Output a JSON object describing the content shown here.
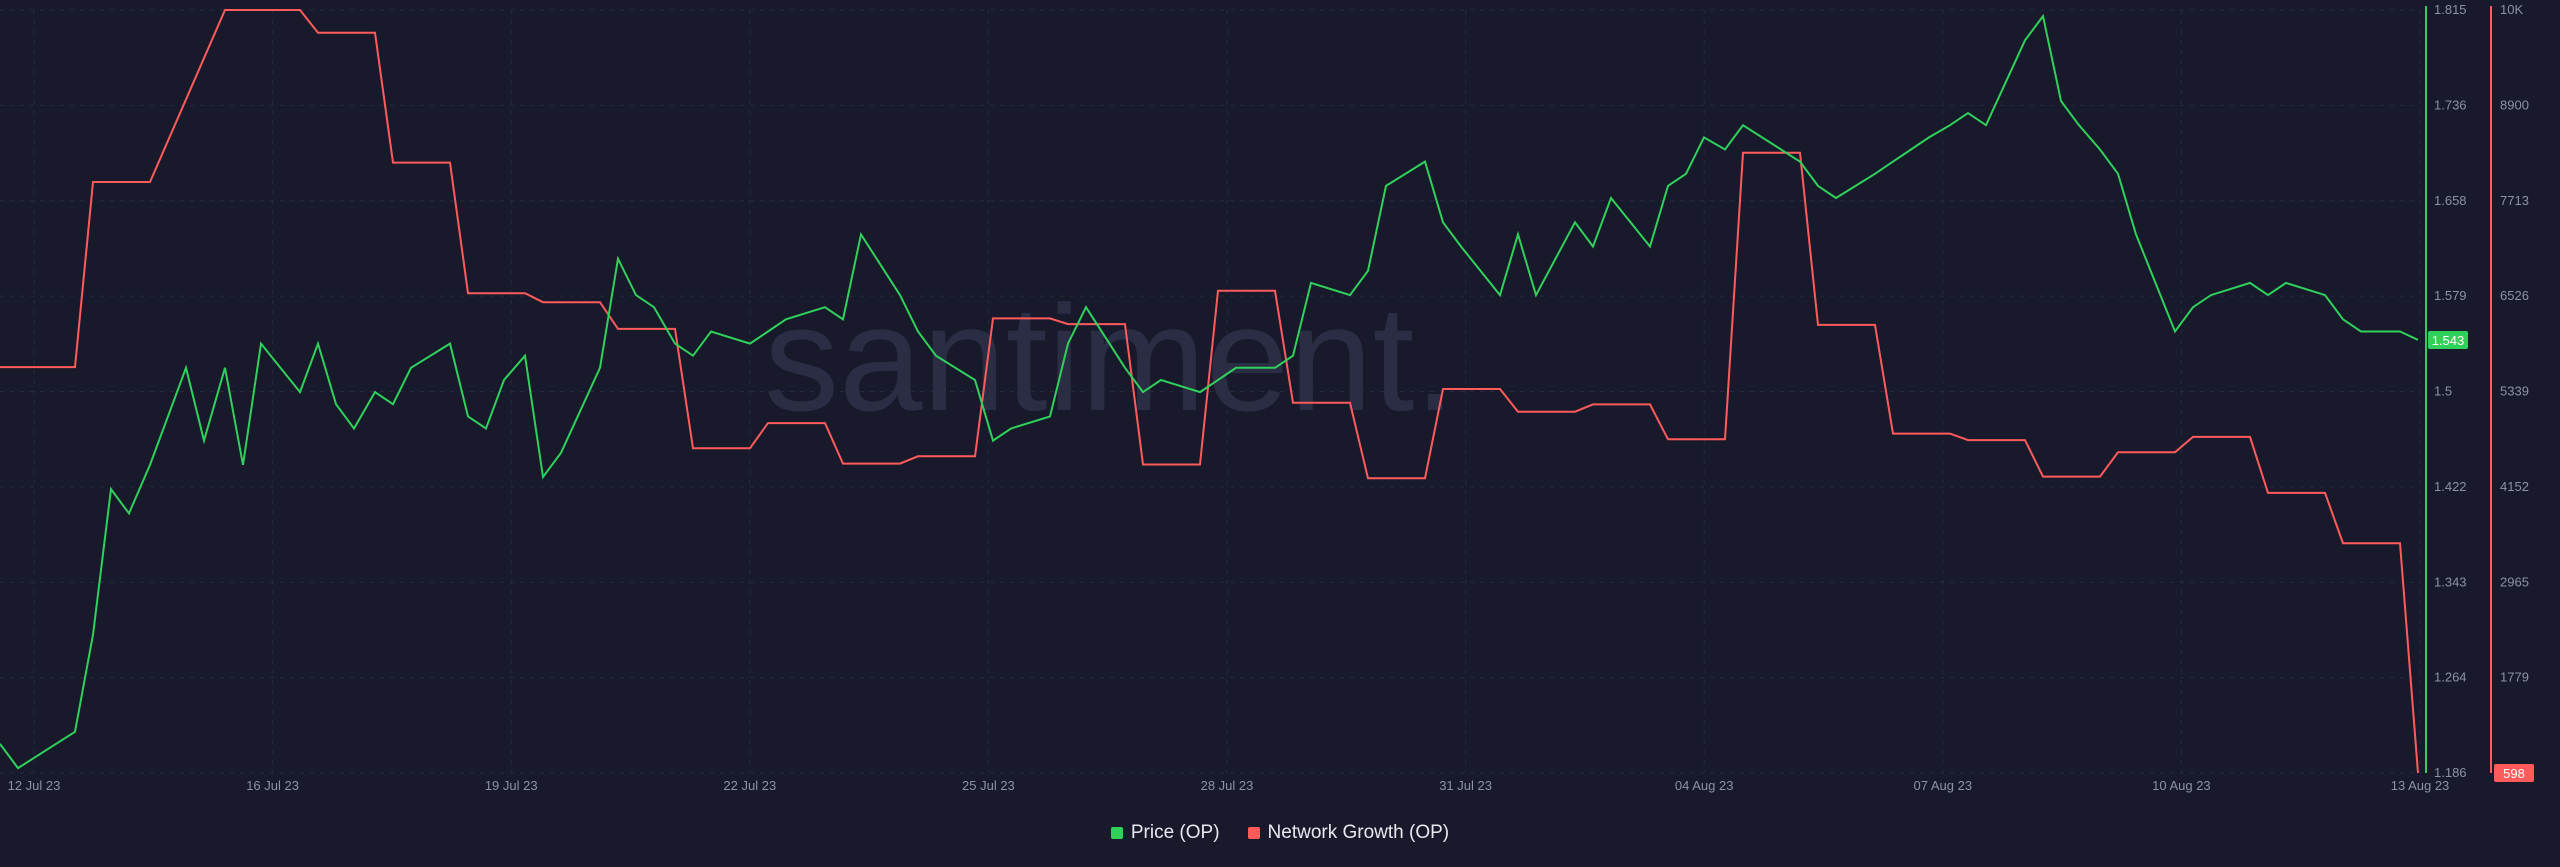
{
  "watermark": "santiment.",
  "colors": {
    "background": "#181a2c",
    "grid": "#262a3f",
    "price": "#2fd15a",
    "network": "#ff5b5b",
    "tick": "#8d90a6"
  },
  "legend": [
    {
      "label": "Price (OP)",
      "color": "#2fd15a"
    },
    {
      "label": "Network Growth (OP)",
      "color": "#ff5b5b"
    }
  ],
  "chart_data": {
    "type": "line",
    "x_ticks": [
      "12 Jul 23",
      "16 Jul 23",
      "19 Jul 23",
      "22 Jul 23",
      "25 Jul 23",
      "28 Jul 23",
      "31 Jul 23",
      "04 Aug 23",
      "07 Aug 23",
      "10 Aug 23",
      "13 Aug 23"
    ],
    "x_range": [
      "2023-07-12",
      "2023-08-13"
    ],
    "price_axis": {
      "ticks": [
        "1.815",
        "1.736",
        "1.658",
        "1.579",
        "1.5",
        "1.422",
        "1.343",
        "1.264",
        "1.186"
      ],
      "ylim": [
        1.186,
        1.815
      ],
      "current": "1.543"
    },
    "network_axis": {
      "ticks": [
        "10K",
        "8900",
        "7713",
        "6526",
        "5339",
        "4152",
        "2965",
        "1779"
      ],
      "ylim": [
        598,
        10000
      ],
      "current": "598"
    },
    "series": [
      {
        "name": "Price (OP)",
        "axis": "price",
        "points": [
          [
            "2023-07-12",
            1.21
          ],
          [
            "2023-07-12",
            1.19
          ],
          [
            "2023-07-13",
            1.22
          ],
          [
            "2023-07-13",
            1.3
          ],
          [
            "2023-07-13",
            1.42
          ],
          [
            "2023-07-13",
            1.4
          ],
          [
            "2023-07-14",
            1.44
          ],
          [
            "2023-07-14",
            1.48
          ],
          [
            "2023-07-14",
            1.52
          ],
          [
            "2023-07-14",
            1.46
          ],
          [
            "2023-07-15",
            1.52
          ],
          [
            "2023-07-15",
            1.44
          ],
          [
            "2023-07-15",
            1.54
          ],
          [
            "2023-07-16",
            1.5
          ],
          [
            "2023-07-16",
            1.54
          ],
          [
            "2023-07-16",
            1.49
          ],
          [
            "2023-07-16",
            1.47
          ],
          [
            "2023-07-17",
            1.5
          ],
          [
            "2023-07-17",
            1.49
          ],
          [
            "2023-07-17",
            1.52
          ],
          [
            "2023-07-18",
            1.54
          ],
          [
            "2023-07-18",
            1.48
          ],
          [
            "2023-07-18",
            1.47
          ],
          [
            "2023-07-18",
            1.51
          ],
          [
            "2023-07-19",
            1.53
          ],
          [
            "2023-07-19",
            1.43
          ],
          [
            "2023-07-19",
            1.45
          ],
          [
            "2023-07-20",
            1.52
          ],
          [
            "2023-07-20",
            1.61
          ],
          [
            "2023-07-20",
            1.58
          ],
          [
            "2023-07-20",
            1.57
          ],
          [
            "2023-07-21",
            1.54
          ],
          [
            "2023-07-21",
            1.53
          ],
          [
            "2023-07-21",
            1.55
          ],
          [
            "2023-07-22",
            1.54
          ],
          [
            "2023-07-22",
            1.55
          ],
          [
            "2023-07-22",
            1.56
          ],
          [
            "2023-07-23",
            1.57
          ],
          [
            "2023-07-23",
            1.56
          ],
          [
            "2023-07-23",
            1.63
          ],
          [
            "2023-07-24",
            1.58
          ],
          [
            "2023-07-24",
            1.55
          ],
          [
            "2023-07-24",
            1.53
          ],
          [
            "2023-07-25",
            1.51
          ],
          [
            "2023-07-25",
            1.46
          ],
          [
            "2023-07-25",
            1.47
          ],
          [
            "2023-07-26",
            1.48
          ],
          [
            "2023-07-26",
            1.54
          ],
          [
            "2023-07-26",
            1.57
          ],
          [
            "2023-07-27",
            1.52
          ],
          [
            "2023-07-27",
            1.5
          ],
          [
            "2023-07-27",
            1.51
          ],
          [
            "2023-07-28",
            1.5
          ],
          [
            "2023-07-28",
            1.51
          ],
          [
            "2023-07-28",
            1.52
          ],
          [
            "2023-07-29",
            1.52
          ],
          [
            "2023-07-29",
            1.53
          ],
          [
            "2023-07-29",
            1.59
          ],
          [
            "2023-07-30",
            1.58
          ],
          [
            "2023-07-30",
            1.6
          ],
          [
            "2023-07-30",
            1.67
          ],
          [
            "2023-07-31",
            1.69
          ],
          [
            "2023-07-31",
            1.64
          ],
          [
            "2023-07-31",
            1.62
          ],
          [
            "2023-08-01",
            1.58
          ],
          [
            "2023-08-01",
            1.63
          ],
          [
            "2023-08-01",
            1.58
          ],
          [
            "2023-08-02",
            1.64
          ],
          [
            "2023-08-02",
            1.62
          ],
          [
            "2023-08-02",
            1.66
          ],
          [
            "2023-08-03",
            1.62
          ],
          [
            "2023-08-03",
            1.67
          ],
          [
            "2023-08-03",
            1.68
          ],
          [
            "2023-08-03",
            1.71
          ],
          [
            "2023-08-04",
            1.7
          ],
          [
            "2023-08-04",
            1.72
          ],
          [
            "2023-08-05",
            1.69
          ],
          [
            "2023-08-05",
            1.67
          ],
          [
            "2023-08-05",
            1.66
          ],
          [
            "2023-08-06",
            1.68
          ],
          [
            "2023-08-06",
            1.69
          ],
          [
            "2023-08-06",
            1.7
          ],
          [
            "2023-08-06",
            1.71
          ],
          [
            "2023-08-07",
            1.72
          ],
          [
            "2023-08-07",
            1.73
          ],
          [
            "2023-08-07",
            1.72
          ],
          [
            "2023-08-08",
            1.79
          ],
          [
            "2023-08-08",
            1.81
          ],
          [
            "2023-08-08",
            1.74
          ],
          [
            "2023-08-08",
            1.72
          ],
          [
            "2023-08-09",
            1.7
          ],
          [
            "2023-08-09",
            1.68
          ],
          [
            "2023-08-09",
            1.63
          ],
          [
            "2023-08-10",
            1.55
          ],
          [
            "2023-08-10",
            1.57
          ],
          [
            "2023-08-10",
            1.58
          ],
          [
            "2023-08-11",
            1.59
          ],
          [
            "2023-08-11",
            1.58
          ],
          [
            "2023-08-11",
            1.59
          ],
          [
            "2023-08-12",
            1.58
          ],
          [
            "2023-08-12",
            1.56
          ],
          [
            "2023-08-12",
            1.55
          ],
          [
            "2023-08-13",
            1.55
          ],
          [
            "2023-08-13",
            1.543
          ]
        ]
      },
      {
        "name": "Network Growth (OP)",
        "axis": "network",
        "points": [
          [
            "2023-07-12",
            5600
          ],
          [
            "2023-07-13",
            5600
          ],
          [
            "2023-07-13",
            7880
          ],
          [
            "2023-07-14",
            7880
          ],
          [
            "2023-07-15",
            10000
          ],
          [
            "2023-07-16",
            10000
          ],
          [
            "2023-07-16",
            9720
          ],
          [
            "2023-07-17",
            9720
          ],
          [
            "2023-07-17",
            8120
          ],
          [
            "2023-07-18",
            8120
          ],
          [
            "2023-07-18",
            6510
          ],
          [
            "2023-07-19",
            6510
          ],
          [
            "2023-07-19",
            6400
          ],
          [
            "2023-07-20",
            6400
          ],
          [
            "2023-07-20",
            6070
          ],
          [
            "2023-07-21",
            6070
          ],
          [
            "2023-07-21",
            4600
          ],
          [
            "2023-07-22",
            4600
          ],
          [
            "2023-07-22",
            4910
          ],
          [
            "2023-07-23",
            4910
          ],
          [
            "2023-07-23",
            4410
          ],
          [
            "2023-07-24",
            4410
          ],
          [
            "2023-07-24",
            4500
          ],
          [
            "2023-07-25",
            4500
          ],
          [
            "2023-07-25",
            6200
          ],
          [
            "2023-07-26",
            6200
          ],
          [
            "2023-07-26",
            6130
          ],
          [
            "2023-07-27",
            6130
          ],
          [
            "2023-07-27",
            4400
          ],
          [
            "2023-07-28",
            4400
          ],
          [
            "2023-07-28",
            6540
          ],
          [
            "2023-07-29",
            6540
          ],
          [
            "2023-07-29",
            5160
          ],
          [
            "2023-07-30",
            5160
          ],
          [
            "2023-07-30",
            4230
          ],
          [
            "2023-07-31",
            4230
          ],
          [
            "2023-07-31",
            5330
          ],
          [
            "2023-08-01",
            5330
          ],
          [
            "2023-08-01",
            5050
          ],
          [
            "2023-08-02",
            5050
          ],
          [
            "2023-08-02",
            5140
          ],
          [
            "2023-08-03",
            5140
          ],
          [
            "2023-08-03",
            4710
          ],
          [
            "2023-08-04",
            4710
          ],
          [
            "2023-08-04",
            8240
          ],
          [
            "2023-08-05",
            8240
          ],
          [
            "2023-08-05",
            6120
          ],
          [
            "2023-08-06",
            6120
          ],
          [
            "2023-08-06",
            4780
          ],
          [
            "2023-08-07",
            4780
          ],
          [
            "2023-08-07",
            4700
          ],
          [
            "2023-08-08",
            4700
          ],
          [
            "2023-08-08",
            4250
          ],
          [
            "2023-08-09",
            4250
          ],
          [
            "2023-08-09",
            4550
          ],
          [
            "2023-08-10",
            4550
          ],
          [
            "2023-08-10",
            4740
          ],
          [
            "2023-08-11",
            4740
          ],
          [
            "2023-08-11",
            4050
          ],
          [
            "2023-08-12",
            4050
          ],
          [
            "2023-08-12",
            3430
          ],
          [
            "2023-08-13",
            3430
          ],
          [
            "2023-08-13",
            598
          ]
        ]
      }
    ]
  }
}
